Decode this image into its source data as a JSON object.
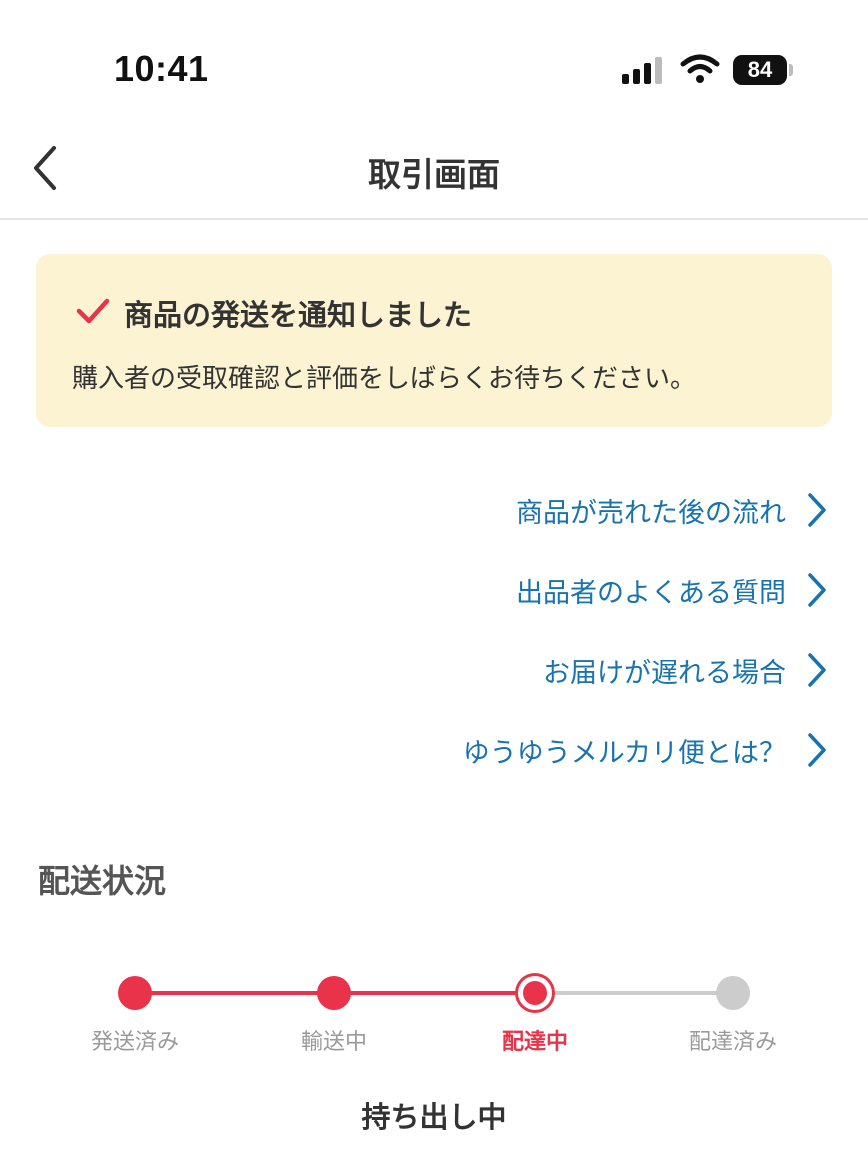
{
  "status_bar": {
    "time": "10:41",
    "battery": "84"
  },
  "nav": {
    "title": "取引画面"
  },
  "notice": {
    "title": "商品の発送を通知しました",
    "body": "購入者の受取確認と評価をしばらくお待ちください。",
    "background": "#fcf3d2",
    "check_color": "#e8334a"
  },
  "help_links": [
    {
      "label": "商品が売れた後の流れ"
    },
    {
      "label": "出品者のよくある質問"
    },
    {
      "label": "お届けが遅れる場合"
    },
    {
      "label": "ゆうゆうメルカリ便とは？"
    }
  ],
  "shipping": {
    "section_title": "配送状況",
    "steps": [
      {
        "label": "発送済み",
        "state": "done"
      },
      {
        "label": "輸送中",
        "state": "done"
      },
      {
        "label": "配達中",
        "state": "current"
      },
      {
        "label": "配達済み",
        "state": "pending"
      }
    ],
    "current_status": "持ち出し中",
    "accent_color": "#e8334a",
    "link_color": "#1a73ad"
  }
}
